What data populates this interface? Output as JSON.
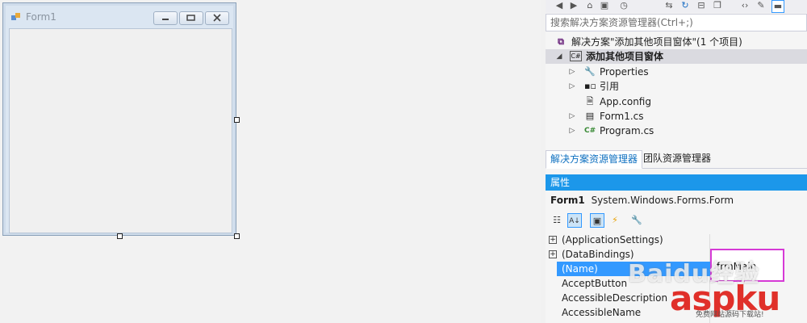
{
  "designer": {
    "form_title": "Form1"
  },
  "solution_explorer": {
    "toolbar_icons": [
      "back-icon",
      "forward-icon",
      "home-icon",
      "solution-view-icon",
      "history-icon",
      "sync-icon",
      "refresh-icon",
      "collapse-all-icon",
      "copy-icon",
      "code-view-icon",
      "properties-icon",
      "auto-hide-icon"
    ],
    "search_placeholder": "搜索解决方案资源管理器(Ctrl+;)",
    "tree": {
      "solution": "解决方案\"添加其他项目窗体\"(1 个项目)",
      "project": "添加其他项目窗体",
      "items": [
        {
          "label": "Properties",
          "icon": "wrench-icon"
        },
        {
          "label": "引用",
          "icon": "references-icon"
        },
        {
          "label": "App.config",
          "icon": "config-file-icon"
        },
        {
          "label": "Form1.cs",
          "icon": "form-file-icon"
        },
        {
          "label": "Program.cs",
          "icon": "csharp-file-icon"
        }
      ]
    },
    "tabs": [
      "解决方案资源管理器",
      "团队资源管理器"
    ]
  },
  "properties": {
    "header": "属性",
    "object_name": "Form1",
    "object_type": "System.Windows.Forms.Form",
    "rows": [
      {
        "name": "(ApplicationSettings)",
        "expandable": true
      },
      {
        "name": "(DataBindings)",
        "expandable": true
      },
      {
        "name": "(Name)",
        "expandable": false,
        "value": "frmMain",
        "selected": true
      },
      {
        "name": "AcceptButton",
        "expandable": false
      },
      {
        "name": "AccessibleDescription",
        "expandable": false
      },
      {
        "name": "AccessibleName",
        "expandable": false
      }
    ]
  },
  "watermarks": {
    "baidu": "Baidu经验",
    "aspku": "aspku",
    "aspku_sub": "免费网站源码下载站!"
  },
  "colors": {
    "accent": "#1c97ea",
    "selection": "#3399ff",
    "highlight_box": "#d63ad6"
  }
}
